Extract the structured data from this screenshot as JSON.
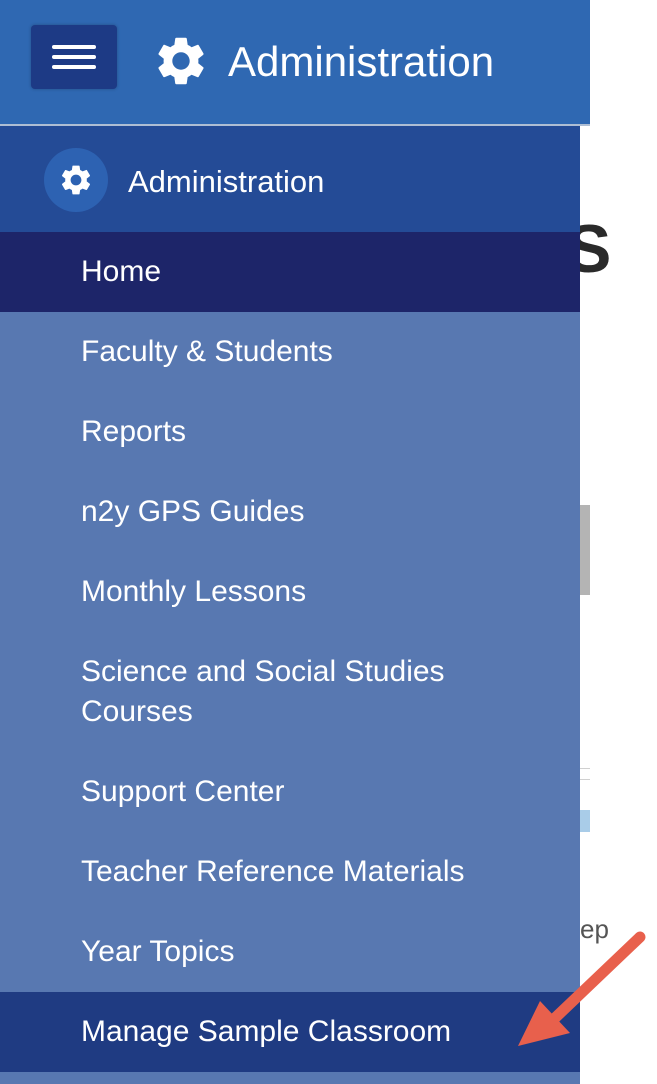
{
  "topbar": {
    "title": "Administration",
    "menu_icon": "hamburger-menu-icon",
    "gear_icon": "gear-icon",
    "background_color": "#2f68b2"
  },
  "sidebar": {
    "header_title": "Administration",
    "header_icon": "gear-icon",
    "items": [
      {
        "label": "Home",
        "state": "active"
      },
      {
        "label": "Faculty & Students"
      },
      {
        "label": "Reports"
      },
      {
        "label": "n2y GPS Guides"
      },
      {
        "label": "Monthly Lessons"
      },
      {
        "label": "Science and Social Studies Courses"
      },
      {
        "label": "Support Center"
      },
      {
        "label": "Teacher Reference Materials"
      },
      {
        "label": "Year Topics"
      },
      {
        "label": "Manage Sample Classroom",
        "state": "highlighted"
      }
    ],
    "colors": {
      "header": "#244b96",
      "item": "#5878b1",
      "active": "#1d2569",
      "highlighted": "#1f3b82"
    }
  },
  "background_page": {
    "heading_fragment": "S",
    "text_fragment": "ep"
  },
  "annotation": {
    "arrow_color": "#e8604c",
    "arrow_icon": "arrow-pointer-icon"
  }
}
